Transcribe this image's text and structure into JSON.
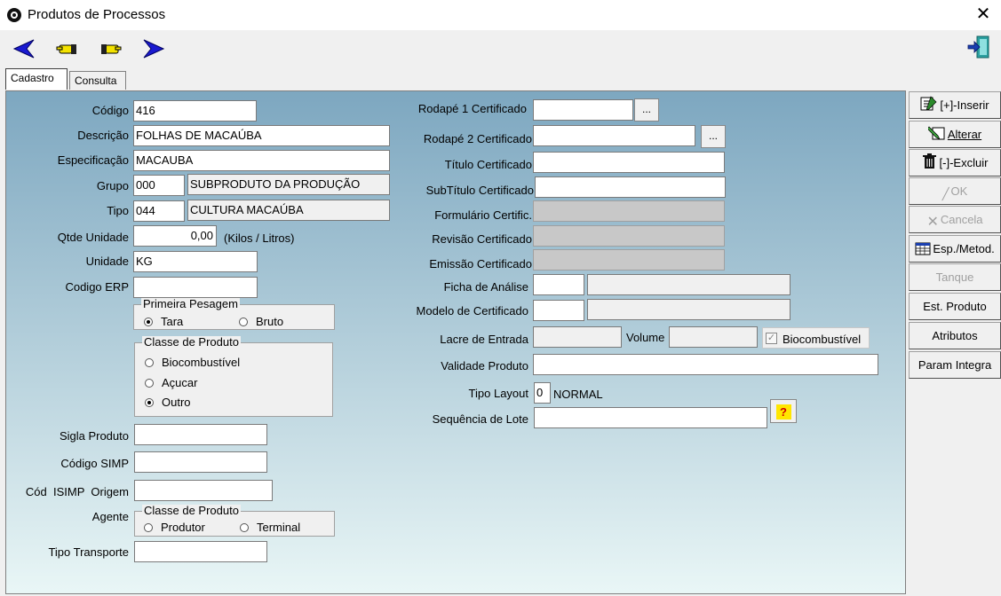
{
  "window": {
    "title": "Produtos de Processos"
  },
  "tabs": [
    {
      "label": "Cadastro"
    },
    {
      "label": "Consulta"
    }
  ],
  "form": {
    "codigo": {
      "label": "Código",
      "value": "416"
    },
    "descricao": {
      "label": "Descrição",
      "value": "FOLHAS DE MACAÚBA"
    },
    "especificacao": {
      "label": "Especificação",
      "value": "MACAUBA"
    },
    "grupo": {
      "label": "Grupo",
      "code": "000",
      "name": "SUBPRODUTO DA PRODUÇÃO"
    },
    "tipo": {
      "label": "Tipo",
      "code": "044",
      "name": "CULTURA MACAÚBA"
    },
    "qtde_unidade": {
      "label": "Qtde Unidade",
      "value": "0,00",
      "suffix": "(Kilos / Litros)"
    },
    "unidade": {
      "label": "Unidade",
      "value": "KG"
    },
    "codigo_erp": {
      "label": "Codigo ERP",
      "value": ""
    },
    "primeira_pesagem": {
      "title": "Primeira Pesagem",
      "options": [
        "Tara",
        "Bruto"
      ],
      "selected": "Tara"
    },
    "classe_produto": {
      "title": "Classe de Produto",
      "options": [
        "Biocombustível",
        "Açucar",
        "Outro"
      ],
      "selected": "Outro"
    },
    "sigla_produto": {
      "label": "Sigla Produto",
      "value": ""
    },
    "codigo_simp": {
      "label": "Código SIMP",
      "value": ""
    },
    "cod_isimp_origem": {
      "label": "Cód  ISIMP  Origem",
      "value": ""
    },
    "agente": {
      "label": "Agente",
      "title": "Classe de Produto",
      "options": [
        "Produtor",
        "Terminal"
      ]
    },
    "tipo_transporte": {
      "label": "Tipo Transporte",
      "value": ""
    },
    "rodape1": {
      "label": "Rodapé 1 Certificado",
      "value": "",
      "button": "..."
    },
    "rodape2": {
      "label": "Rodapé 2 Certificado",
      "value": "",
      "button": "..."
    },
    "titulo_certificado": {
      "label": "Título Certificado",
      "value": ""
    },
    "subtitulo_certificado": {
      "label": "SubTítulo Certificado",
      "value": ""
    },
    "formulario_certific": {
      "label": "Formulário Certific.",
      "value": ""
    },
    "revisao_certificado": {
      "label": "Revisão Certificado",
      "value": ""
    },
    "emissao_certificado": {
      "label": "Emissão Certificado",
      "value": ""
    },
    "ficha_analise": {
      "label": "Ficha de Análise",
      "code": "",
      "name": ""
    },
    "modelo_certificado": {
      "label": "Modelo de Certificado",
      "code": "",
      "name": ""
    },
    "lacre_entrada": {
      "label": "Lacre de Entrada",
      "value": ""
    },
    "volume": {
      "label": "Volume",
      "value": ""
    },
    "biocombustivel": {
      "label": "Biocombustível",
      "checked": true
    },
    "validade_produto": {
      "label": "Validade Produto",
      "value": ""
    },
    "tipo_layout": {
      "label": "Tipo Layout",
      "value": "0",
      "desc": "NORMAL"
    },
    "sequencia_lote": {
      "label": "Sequência de Lote",
      "value": "",
      "help": "?"
    }
  },
  "side_buttons": {
    "inserir": "[+]-Inserir",
    "alterar": "Alterar",
    "excluir": "[-]-Excluir",
    "ok": "OK",
    "cancela": "Cancela",
    "esp_metod": "Esp./Metod.",
    "tanque": "Tanque",
    "est_produto": "Est. Produto",
    "atributos": "Atributos",
    "param_integra": "Param Integra"
  },
  "colors": {
    "panel_top": "#7da7c0",
    "panel_bottom": "#e9f6f6",
    "nav_arrow": "#1010c0"
  }
}
